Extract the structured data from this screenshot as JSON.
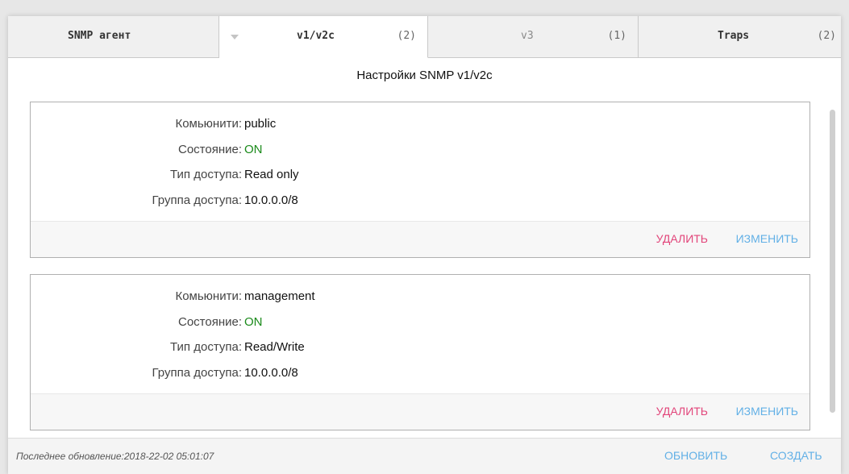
{
  "tabs": [
    {
      "name": "SNMP агент",
      "count": ""
    },
    {
      "name": "v1/v2c",
      "count": "(2)"
    },
    {
      "name": "v3",
      "count": "(1)"
    },
    {
      "name": "Traps",
      "count": "(2)"
    }
  ],
  "settings_title": "Настройки SNMP v1/v2c",
  "labels": {
    "community": "Комьюнити:",
    "state": "Состояние:",
    "access_type": "Тип доступа:",
    "access_group": "Группа доступа:"
  },
  "communities": [
    {
      "community": "public",
      "state": "ON",
      "access_type": "Read only",
      "access_group": "10.0.0.0/8"
    },
    {
      "community": "management",
      "state": "ON",
      "access_type": "Read/Write",
      "access_group": "10.0.0.0/8"
    }
  ],
  "actions": {
    "delete": "УДАЛИТЬ",
    "edit": "ИЗМЕНИТЬ"
  },
  "footer": {
    "last_update": "Последнее обновление:2018-22-02 05:01:07",
    "refresh": "ОБНОВИТЬ",
    "create": "СОЗДАТЬ"
  },
  "colors": {
    "on": "#1a8a1a",
    "delete": "#e2457a",
    "link": "#62b0e6"
  }
}
